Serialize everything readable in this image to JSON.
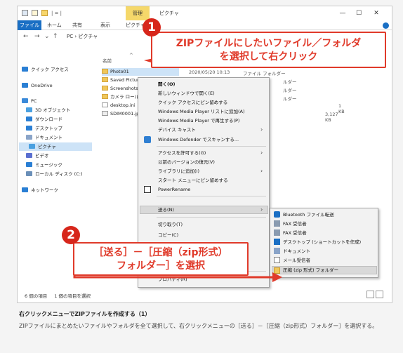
{
  "window": {
    "contextual_tab": "管理",
    "title": "ピクチャ",
    "ribbon_tabs": [
      "ファイル",
      "ホーム",
      "共有",
      "表示",
      "ピクチャ"
    ],
    "nav_arrows": [
      "←",
      "→",
      "⌄",
      "↑"
    ],
    "address": "PC › ピクチャ",
    "minimize": "—",
    "maximize": "☐",
    "close": "✕",
    "qa_sep": "|  =  |"
  },
  "nav_pane": [
    {
      "label": "クイック アクセス",
      "icon": "star-icon",
      "color": "#2a7fd4"
    },
    {
      "label": "OneDrive",
      "icon": "cloud-icon",
      "color": "#2a7fd4"
    },
    {
      "label": "PC",
      "icon": "pc-icon",
      "color": "#3b8ad9"
    },
    {
      "label": "3D オブジェクト",
      "icon": "cube-icon",
      "color": "#4aa0e0"
    },
    {
      "label": "ダウンロード",
      "icon": "download-icon",
      "color": "#2a7fd4"
    },
    {
      "label": "デスクトップ",
      "icon": "desktop-icon",
      "color": "#2a7fd4"
    },
    {
      "label": "ドキュメント",
      "icon": "document-icon",
      "color": "#8aa4c8"
    },
    {
      "label": "ピクチャ",
      "icon": "picture-icon",
      "color": "#4aa0e0"
    },
    {
      "label": "ビデオ",
      "icon": "video-icon",
      "color": "#5a6fd0"
    },
    {
      "label": "ミュージック",
      "icon": "music-icon",
      "color": "#2a7fd4"
    },
    {
      "label": "ローカル ディスク (C:)",
      "icon": "disk-icon",
      "color": "#6a8fb8"
    },
    {
      "label": "ネットワーク",
      "icon": "network-icon",
      "color": "#2a7fd4"
    }
  ],
  "file_list": {
    "col_name": "名前",
    "sort_arrow": "^",
    "rows": [
      {
        "name": "Photo01",
        "date": "2020/05/20 10:13",
        "type": "ファイル フォルダー",
        "size": ""
      },
      {
        "name": "Saved Pictures",
        "date": "",
        "type": "ルダー",
        "size": ""
      },
      {
        "name": "Screenshots",
        "date": "",
        "type": "ルダー",
        "size": ""
      },
      {
        "name": "カメラ ロール",
        "date": "",
        "type": "ルダー",
        "size": ""
      },
      {
        "name": "desktop.ini",
        "date": "",
        "type": "",
        "size": "1 KB"
      },
      {
        "name": "SDIM0001.jpg",
        "date": "",
        "type": "",
        "size": "3,127 KB"
      }
    ]
  },
  "context_menu": {
    "items": [
      {
        "label": "開く(O)",
        "bold": true
      },
      {
        "label": "新しいウィンドウで開く(E)"
      },
      {
        "label": "クイック アクセスにピン留めする"
      },
      {
        "label": "Windows Media Player リストに追加(A)"
      },
      {
        "label": "Windows Media Player で再生する(P)"
      },
      {
        "label": "デバイス キャスト",
        "arrow": "›"
      },
      {
        "label": "Windows Defender でスキャンする..."
      },
      {
        "label": "アクセスを許可する(G)",
        "arrow": "›"
      },
      {
        "label": "以前のバージョンの復元(V)"
      },
      {
        "label": "ライブラリに追加(I)",
        "arrow": "›"
      },
      {
        "label": "スタート メニューにピン留めする"
      },
      {
        "label": "PowerRename"
      },
      {
        "label": "送る(N)",
        "arrow": "›"
      },
      {
        "label": "切り取り(T)"
      },
      {
        "label": "コピー(C)"
      },
      {
        "label": "プロパティ(R)"
      }
    ]
  },
  "send_to_menu": {
    "items": [
      {
        "label": "Bluetooth ファイル転送",
        "icon": "bluetooth-icon"
      },
      {
        "label": "FAX 受信者",
        "icon": "fax-icon"
      },
      {
        "label": "FAX 受信者",
        "icon": "fax-icon"
      },
      {
        "label": "デスクトップ (ショートカットを作成)",
        "icon": "desktop-icon"
      },
      {
        "label": "ドキュメント",
        "icon": "document-icon"
      },
      {
        "label": "メール受信者",
        "icon": "mail-icon"
      },
      {
        "label": "圧縮 (zip 形式) フォルダー",
        "icon": "zip-folder-icon"
      }
    ]
  },
  "status": {
    "count": "6 個の項目",
    "selected": "1 個の項目を選択"
  },
  "callouts": {
    "one": {
      "number": "1",
      "line1": "ZIPファイルにしたいファイル／フォルダ",
      "line2": "を選択して右クリック"
    },
    "two": {
      "number": "2",
      "line1": "［送る］－［圧縮（zip形式）",
      "line2": "フォルダー］を選択"
    }
  },
  "caption": {
    "title": "右クリックメニューでZIPファイルを作成する（1）",
    "body": "ZIPファイルにまとめたいファイルやフォルダを全て選択して、右クリックメニューの［送る］－［圧縮（zip形式）フォルダー］を選択する。"
  },
  "colors": {
    "accent": "#1a6fc4",
    "callout": "#e03a2a",
    "badge": "#d7261b",
    "selection": "#cde3f7"
  }
}
